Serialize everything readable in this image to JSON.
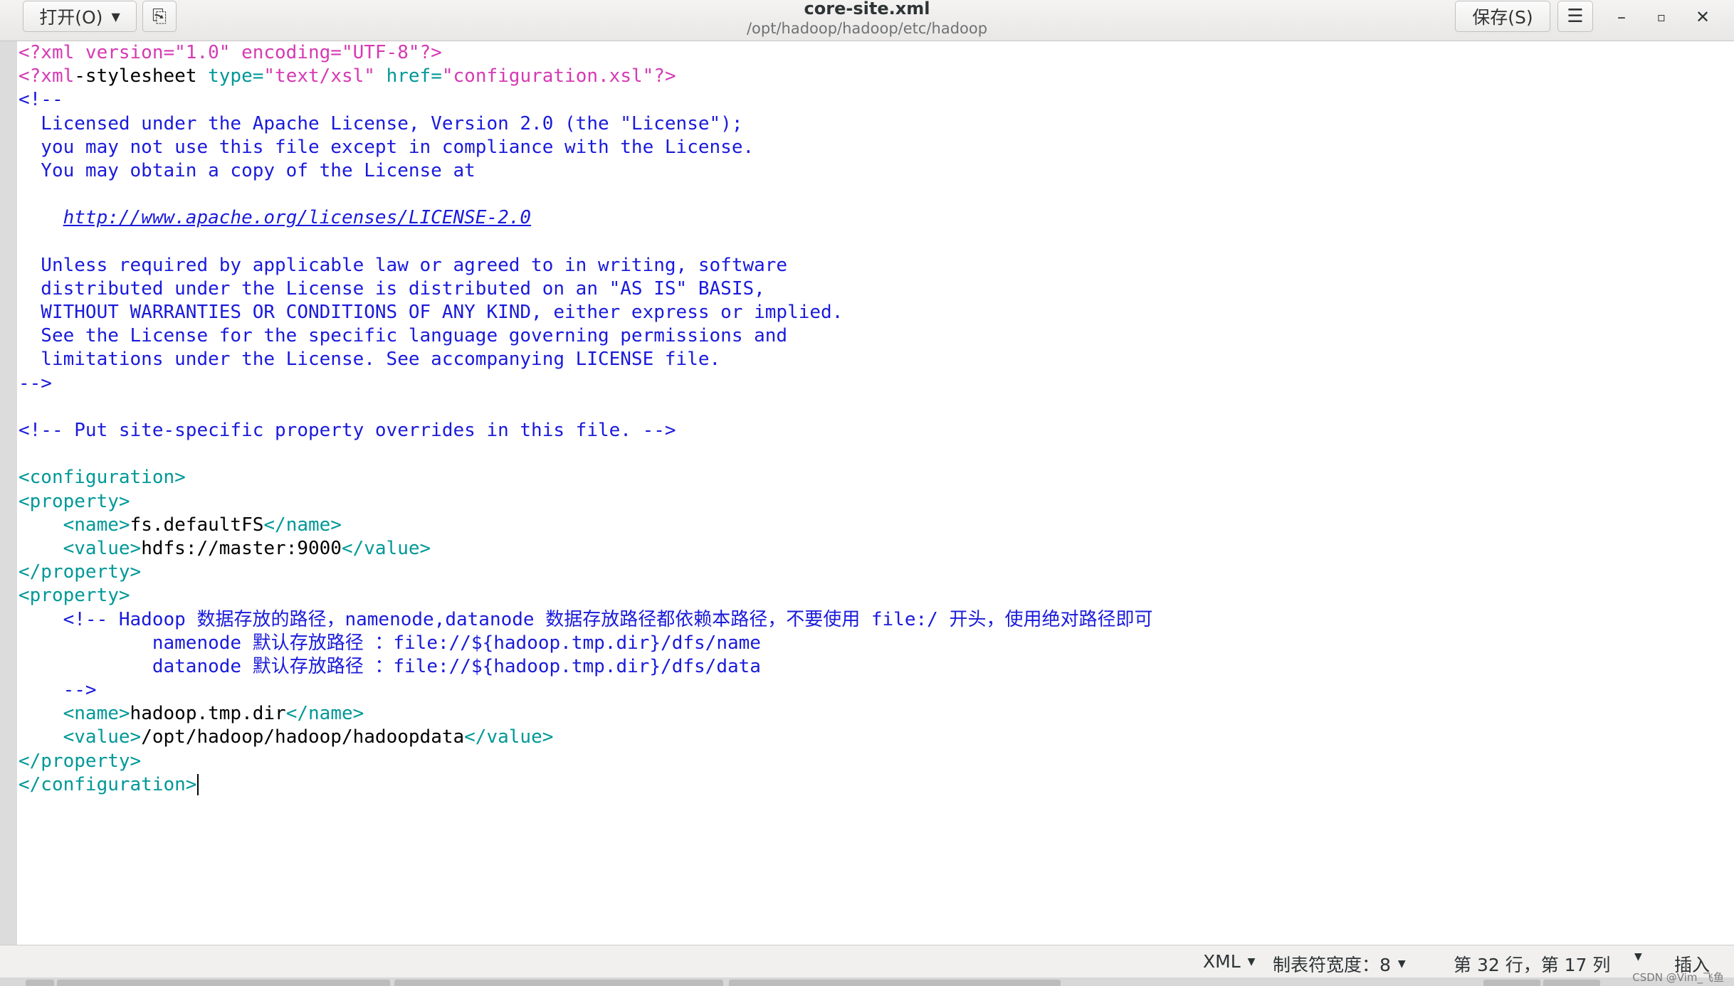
{
  "titlebar": {
    "open_label": "打开(O)",
    "open_arrow": "▼",
    "pin_icon": "⎘",
    "title": "core-site.xml",
    "path": "/opt/hadoop/hadoop/etc/hadoop",
    "save_label": "保存(S)",
    "menu_icon": "☰",
    "min_icon": "–",
    "max_icon": "▫",
    "close_icon": "✕"
  },
  "editor": {
    "lines": [
      [
        {
          "c": "pi",
          "t": "<?xml version=\"1.0\" encoding=\"UTF-8\"?>"
        }
      ],
      [
        {
          "c": "pi",
          "t": "<?xml"
        },
        {
          "c": "tx",
          "t": "-stylesheet "
        },
        {
          "c": "kw",
          "t": "type="
        },
        {
          "c": "pi",
          "t": "\"text/xsl\" "
        },
        {
          "c": "kw",
          "t": "href="
        },
        {
          "c": "pi",
          "t": "\"configuration.xsl\"?>"
        }
      ],
      [
        {
          "c": "cm",
          "t": "<!--"
        }
      ],
      [
        {
          "c": "cm",
          "t": "  Licensed under the Apache License, Version 2.0 (the \"License\");"
        }
      ],
      [
        {
          "c": "cm",
          "t": "  you may not use this file except in compliance with the License."
        }
      ],
      [
        {
          "c": "cm",
          "t": "  You may obtain a copy of the License at"
        }
      ],
      [
        {
          "c": "cm",
          "t": ""
        }
      ],
      [
        {
          "c": "cm",
          "t": "    "
        },
        {
          "c": "url",
          "t": "http://www.apache.org/licenses/LICENSE-2.0"
        }
      ],
      [
        {
          "c": "cm",
          "t": ""
        }
      ],
      [
        {
          "c": "cm",
          "t": "  Unless required by applicable law or agreed to in writing, software"
        }
      ],
      [
        {
          "c": "cm",
          "t": "  distributed under the License is distributed on an \"AS IS\" BASIS,"
        }
      ],
      [
        {
          "c": "cm",
          "t": "  WITHOUT WARRANTIES OR CONDITIONS OF ANY KIND, either express or implied."
        }
      ],
      [
        {
          "c": "cm",
          "t": "  See the License for the specific language governing permissions and"
        }
      ],
      [
        {
          "c": "cm",
          "t": "  limitations under the License. See accompanying LICENSE file."
        }
      ],
      [
        {
          "c": "cm",
          "t": "-->"
        }
      ],
      [
        {
          "c": "tx",
          "t": ""
        }
      ],
      [
        {
          "c": "cm",
          "t": "<!-- Put site-specific property overrides in this file. -->"
        }
      ],
      [
        {
          "c": "tx",
          "t": ""
        }
      ],
      [
        {
          "c": "kw",
          "t": "<configuration>"
        }
      ],
      [
        {
          "c": "kw",
          "t": "<property>"
        }
      ],
      [
        {
          "c": "tx",
          "t": "    "
        },
        {
          "c": "kw",
          "t": "<name>"
        },
        {
          "c": "tx",
          "t": "fs.defaultFS"
        },
        {
          "c": "kw",
          "t": "</name>"
        }
      ],
      [
        {
          "c": "tx",
          "t": "    "
        },
        {
          "c": "kw",
          "t": "<value>"
        },
        {
          "c": "tx",
          "t": "hdfs://master:9000"
        },
        {
          "c": "kw",
          "t": "</value>"
        }
      ],
      [
        {
          "c": "kw",
          "t": "</property>"
        }
      ],
      [
        {
          "c": "kw",
          "t": "<property>"
        }
      ],
      [
        {
          "c": "cm",
          "t": "    <!-- Hadoop 数据存放的路径，namenode,datanode 数据存放路径都依赖本路径，不要使用 file:/ 开头，使用绝对路径即可"
        }
      ],
      [
        {
          "c": "cm",
          "t": "            namenode 默认存放路径 ：file://${hadoop.tmp.dir}/dfs/name"
        }
      ],
      [
        {
          "c": "cm",
          "t": "            datanode 默认存放路径 ：file://${hadoop.tmp.dir}/dfs/data"
        }
      ],
      [
        {
          "c": "cm",
          "t": "    -->"
        }
      ],
      [
        {
          "c": "tx",
          "t": "    "
        },
        {
          "c": "kw",
          "t": "<name>"
        },
        {
          "c": "tx",
          "t": "hadoop.tmp.dir"
        },
        {
          "c": "kw",
          "t": "</name>"
        }
      ],
      [
        {
          "c": "tx",
          "t": "    "
        },
        {
          "c": "kw",
          "t": "<value>"
        },
        {
          "c": "tx",
          "t": "/opt/hadoop/hadoop/hadoopdata"
        },
        {
          "c": "kw",
          "t": "</value>"
        }
      ],
      [
        {
          "c": "kw",
          "t": "</property>"
        }
      ],
      [
        {
          "c": "kw",
          "t": "</configuration>"
        }
      ]
    ]
  },
  "statusbar": {
    "language": "XML",
    "tab_width": "制表符宽度：8",
    "position": "第 32 行，第 17 列",
    "mode": "插入",
    "caret_icon": "▼"
  },
  "watermark": "CSDN @Vim_飞鱼",
  "colors": {
    "processing_instruction": "#d63ab3",
    "tag": "#009897",
    "comment": "#1a1adb",
    "text": "#000000"
  }
}
